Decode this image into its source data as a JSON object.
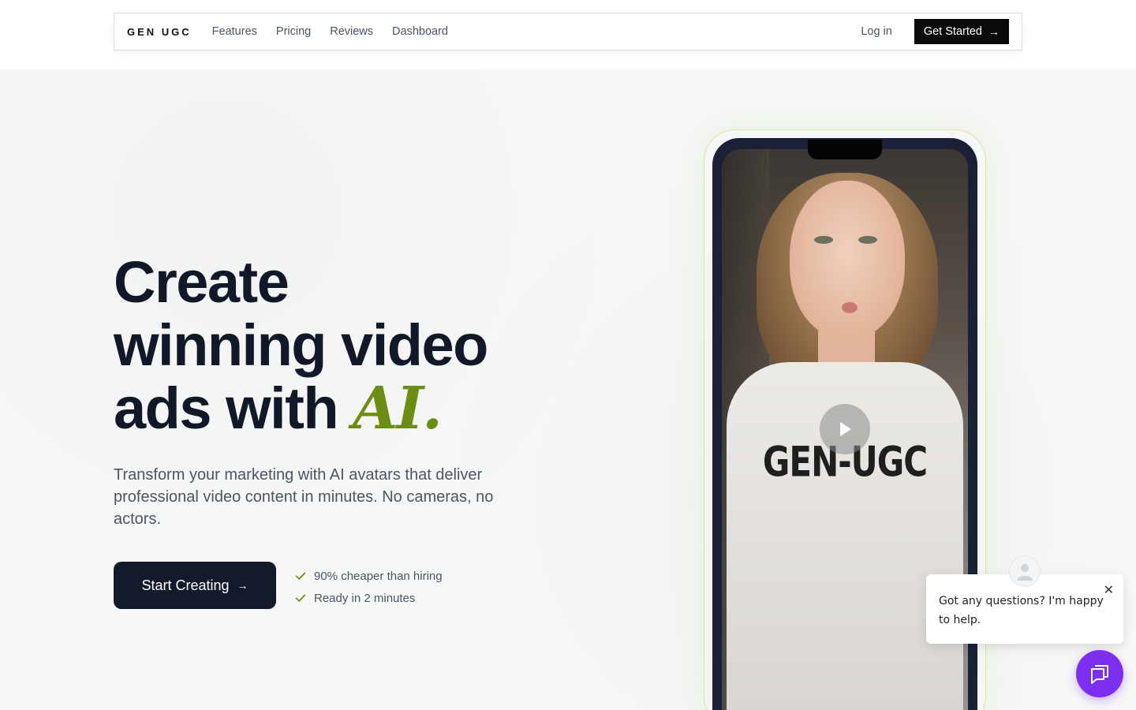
{
  "nav": {
    "logo": "GEN UGC",
    "links": [
      "Features",
      "Pricing",
      "Reviews",
      "Dashboard"
    ],
    "login": "Log in",
    "cta": "Get Started"
  },
  "hero": {
    "title_line1": "Create",
    "title_line2": "winning video",
    "title_line3": "ads with",
    "title_highlight": "AI.",
    "subtitle": "Transform your marketing with AI avatars that deliver professional video content in minutes. No cameras, no actors.",
    "cta": "Start Creating",
    "benefits": [
      "90% cheaper than hiring",
      "Ready in 2 minutes"
    ],
    "accent_color": "#6b8e12"
  },
  "video": {
    "shirt_text": "GEN-UGC",
    "play_icon": "play-icon"
  },
  "chat": {
    "message": "Got any questions? I'm happy to help.",
    "close_icon": "close-icon",
    "launcher_icon": "chat-icon",
    "launcher_color": "#7c2ff0"
  }
}
